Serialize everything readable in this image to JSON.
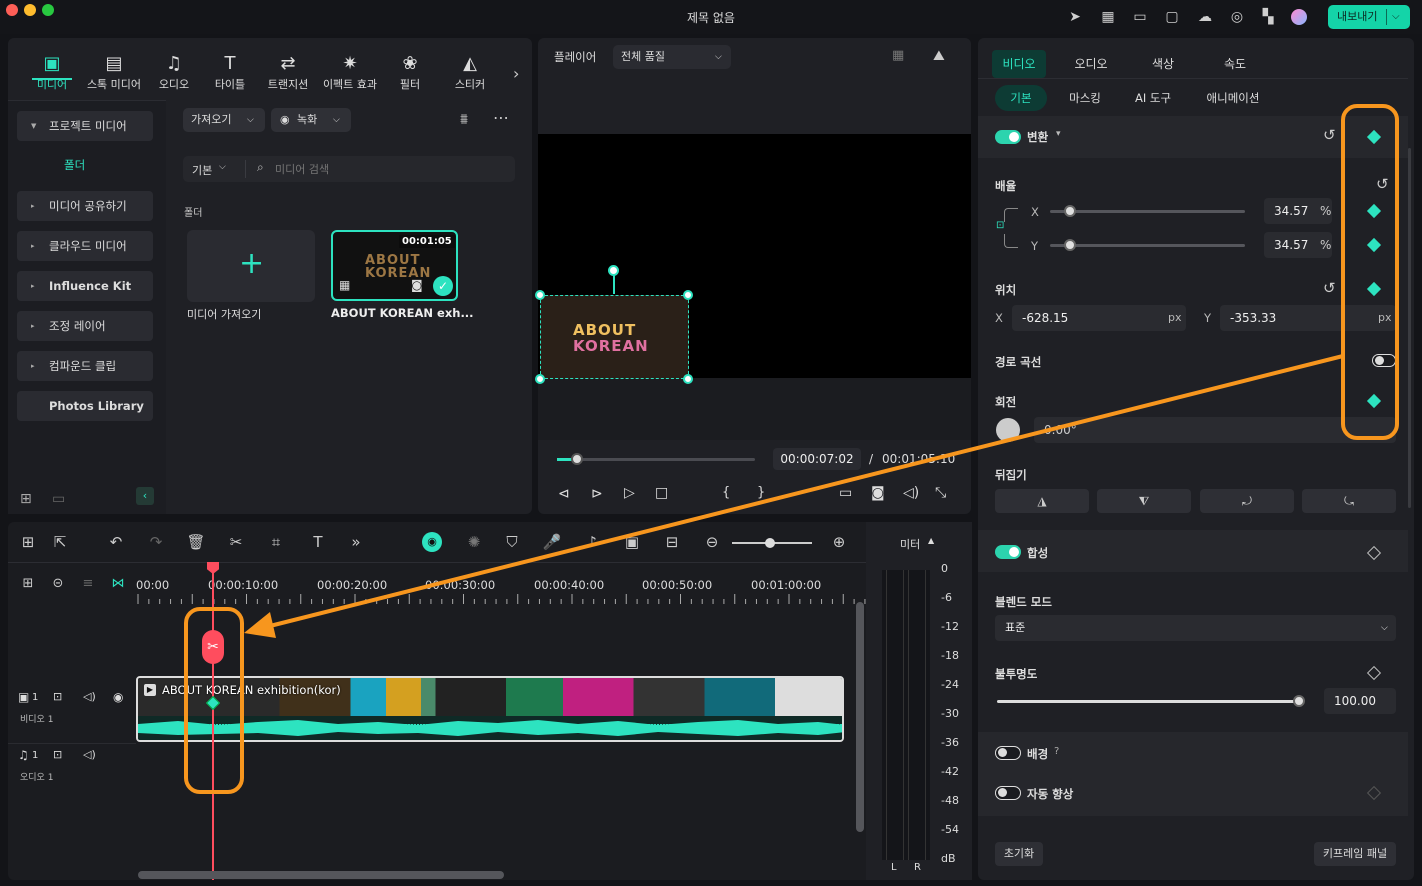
{
  "window": {
    "title": "제목 없음",
    "export_label": "내보내기"
  },
  "media_tabs": [
    {
      "label": "미디어",
      "icon": "media-icon",
      "glyph": "▣"
    },
    {
      "label": "스톡 미디어",
      "icon": "stock-media-icon",
      "glyph": "▤"
    },
    {
      "label": "오디오",
      "icon": "audio-note-icon",
      "glyph": "♫"
    },
    {
      "label": "타이틀",
      "icon": "title-t-icon",
      "glyph": "T"
    },
    {
      "label": "트랜지션",
      "icon": "transition-icon",
      "glyph": "⇄"
    },
    {
      "label": "이펙트 효과",
      "icon": "effect-sparkle-icon",
      "glyph": "✷"
    },
    {
      "label": "필터",
      "icon": "filter-icon",
      "glyph": "❀"
    },
    {
      "label": "스티커",
      "icon": "sticker-icon",
      "glyph": "◭"
    }
  ],
  "sidebar": {
    "project_media": "프로젝트 미디어",
    "folder": "폴더",
    "items": [
      "미디어 공유하기",
      "클라우드 미디어",
      "Influence Kit",
      "조정 레이어",
      "컴파운드 클립",
      "Photos Library"
    ]
  },
  "media_toolbar": {
    "import_label": "가져오기",
    "record_label": "녹화",
    "sort_label": "기본",
    "search_placeholder": "미디어 검색",
    "folder_heading": "폴더"
  },
  "media_cards": [
    {
      "label": "미디어 가져오기"
    },
    {
      "label": "ABOUT KOREAN exh...",
      "duration": "00:01:05",
      "thumb_text_1": "ABOUT",
      "thumb_text_2": "KOREAN"
    }
  ],
  "player": {
    "label": "플레이어",
    "quality": "전체 품질",
    "current_time": "00:00:07:02",
    "separator": "/",
    "total_time": "00:01:05:10",
    "overlay_text_1": "ABOUT",
    "overlay_text_2": "KOREAN",
    "progress": 0.1
  },
  "props": {
    "tabs": [
      "비디오",
      "오디오",
      "색상",
      "속도"
    ],
    "subtabs": [
      "기본",
      "마스킹",
      "AI 도구",
      "애니메이션"
    ],
    "transform_label": "변환",
    "scale_label": "배율",
    "x_label": "X",
    "y_label": "Y",
    "scale_x": "34.57",
    "scale_y": "34.57",
    "percent": "%",
    "position_label": "위치",
    "pos_x": "-628.15",
    "pos_y": "-353.33",
    "px": "px",
    "path_curve_label": "경로 곡선",
    "rotation_label": "회전",
    "rotation_value": "0.00°",
    "flip_label": "뒤집기",
    "composite_label": "합성",
    "blend_mode_label": "블렌드 모드",
    "blend_mode_value": "표준",
    "opacity_label": "불투명도",
    "opacity_value": "100.00",
    "background_label": "배경",
    "auto_enhance_label": "자동 향상",
    "reset_label": "초기화",
    "keyframe_panel_label": "키프레임 패널",
    "accent": "#2de3c0"
  },
  "timeline": {
    "ruler": [
      "00:00",
      "00:00:10:00",
      "00:00:20:00",
      "00:00:30:00",
      "00:00:40:00",
      "00:00:50:00",
      "00:01:00:00"
    ],
    "clip_title": "ABOUT KOREAN exhibition(kor)",
    "video_track": "비디오 1",
    "audio_track": "오디오 1",
    "track_v_num": "1",
    "track_a_num": "1",
    "meter_label": "미터",
    "meter_scale": [
      "0",
      "-6",
      "-12",
      "-18",
      "-24",
      "-30",
      "-36",
      "-42",
      "-48",
      "-54",
      "dB"
    ],
    "meter_l": "L",
    "meter_r": "R",
    "playhead_color": "#ff4d5e",
    "annotation_color": "#f7961e"
  }
}
